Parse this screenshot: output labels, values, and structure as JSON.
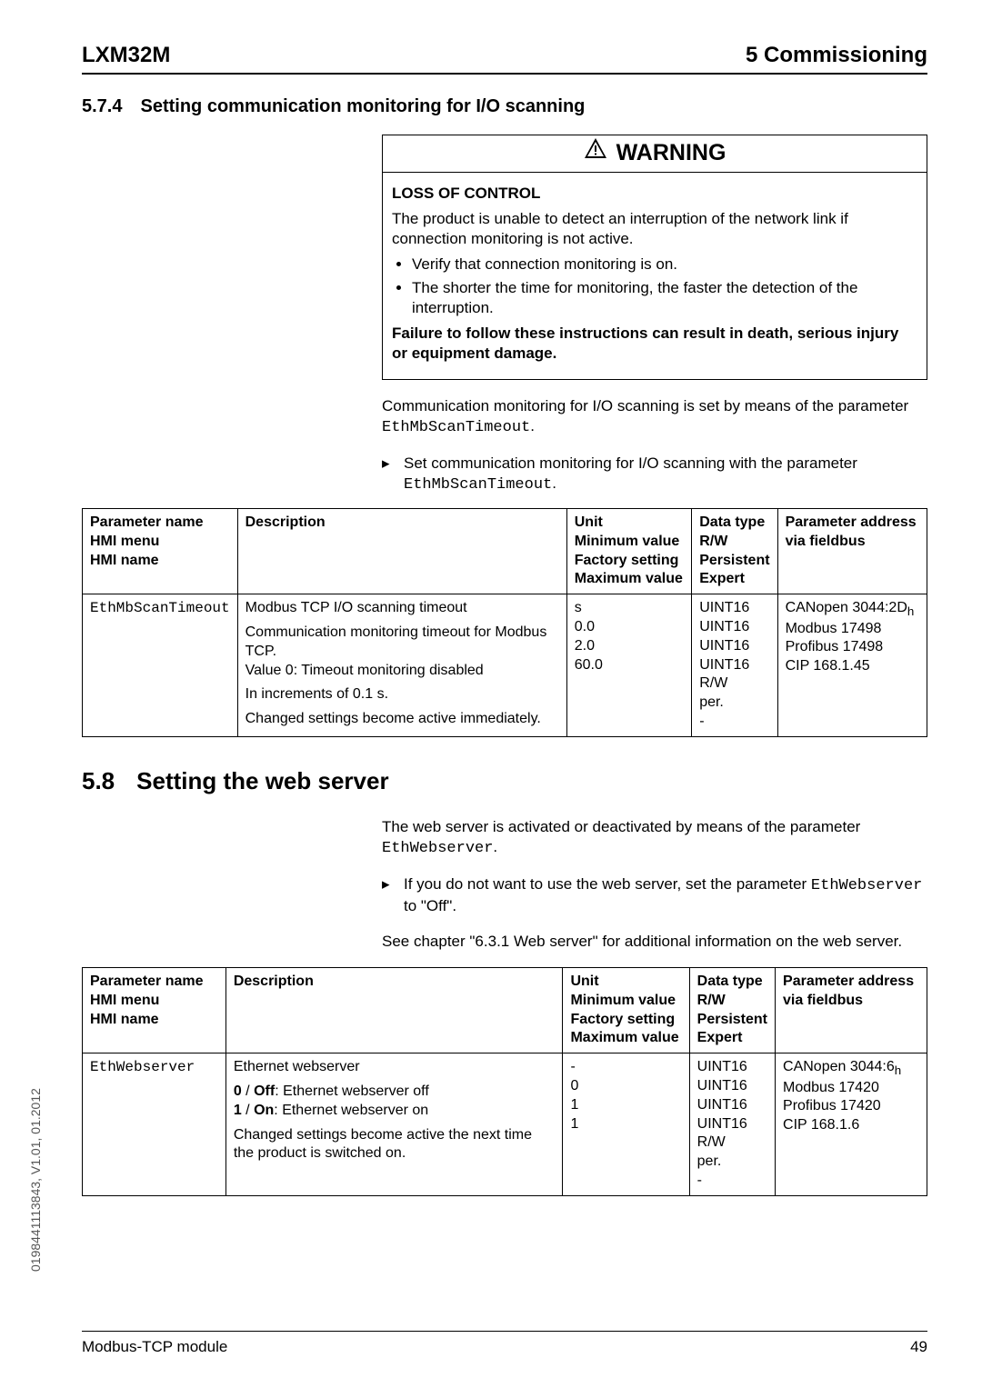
{
  "header": {
    "left": "LXM32M",
    "right": "5 Commissioning"
  },
  "sidetext": "0198441113843, V1.01, 01.2012",
  "footer": {
    "left": "Modbus-TCP module",
    "right": "49"
  },
  "s574": {
    "num": "5.7.4",
    "title": "Setting communication monitoring for I/O scanning"
  },
  "warning": {
    "title": "WARNING",
    "subtitle": "LOSS OF CONTROL",
    "p1": "The product is unable to detect an interruption of the network link if connection monitoring is not active.",
    "bullet1": "Verify that connection monitoring is on.",
    "bullet2": "The shorter the time for monitoring, the faster the detection of the interruption.",
    "p2": "Failure to follow these instructions can result in death, serious injury or equipment damage."
  },
  "txt574": {
    "p1a": "Communication monitoring for I/O scanning is set by means of the parameter ",
    "p1b": "EthMbScanTimeout",
    "p1c": ".",
    "arrow1a": "Set communication monitoring for I/O scanning with the parameter ",
    "arrow1b": "EthMbScanTimeout",
    "arrow1c": "."
  },
  "table_head": {
    "c1": "Parameter name\nHMI menu\nHMI name",
    "c2": "Description",
    "c3": "Unit\nMinimum value\nFactory setting\nMaximum value",
    "c4": "Data type\nR/W\nPersistent\nExpert",
    "c5": "Parameter address via fieldbus"
  },
  "table1": {
    "c1": "EthMbScanTimeout",
    "c2a": "Modbus TCP I/O scanning timeout",
    "c2b": "Communication monitoring timeout for Modbus TCP.\nValue 0: Timeout monitoring disabled",
    "c2c": "In increments of 0.1 s.",
    "c2d": "Changed settings become active immediately.",
    "c3": "s\n0.0\n2.0\n60.0",
    "c4": "UINT16\nUINT16\nUINT16\nUINT16\nR/W\nper.\n-",
    "c5a": "CANopen 3044:2D",
    "c5a_sub": "h",
    "c5b": "Modbus 17498\nProfibus 17498\nCIP 168.1.45"
  },
  "s58": {
    "num": "5.8",
    "title": "Setting the web server"
  },
  "txt58": {
    "p1a": "The web server is activated or deactivated by means of the parameter ",
    "p1b": "EthWebserver",
    "p1c": ".",
    "arrow1a": "If you do not want to use the web server, set the parameter ",
    "arrow1b": "EthWebserver",
    "arrow1c": " to \"Off\".",
    "p2": "See chapter \"6.3.1 Web server\" for additional information on the web server."
  },
  "table2": {
    "c1": "EthWebserver",
    "c2a": "Ethernet webserver",
    "c2b_strong1": "0",
    "c2b_rest1": " / ",
    "c2b_strong2": "Off",
    "c2b_rest2": ": Ethernet webserver off",
    "c2c_strong1": "1",
    "c2c_rest1": " / ",
    "c2c_strong2": "On",
    "c2c_rest2": ": Ethernet webserver on",
    "c2d": "Changed settings become active the next time the product is switched on.",
    "c3": "-\n0\n1\n1",
    "c4": "UINT16\nUINT16\nUINT16\nUINT16\nR/W\nper.\n-",
    "c5a": "CANopen 3044:6",
    "c5a_sub": "h",
    "c5b": "Modbus 17420\nProfibus 17420\nCIP 168.1.6"
  }
}
